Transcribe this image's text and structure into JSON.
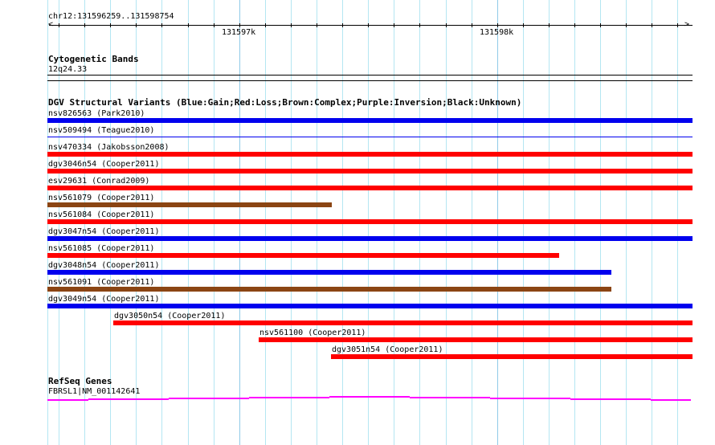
{
  "ruler": {
    "region": "chr12:131596259..131598754",
    "ticks": [
      "131597k",
      "131598k"
    ]
  },
  "cytoband": {
    "title": "Cytogenetic Bands",
    "band": "12q24.33"
  },
  "dgv": {
    "title": "DGV Structural Variants (Blue:Gain;Red:Loss;Brown:Complex;Purple:Inversion;Black:Unknown)",
    "colors": {
      "gain": "#0000ee",
      "loss": "#ff0000",
      "complex": "#8b4513"
    },
    "rows": [
      {
        "label": "nsv826563 (Park2010)",
        "type": "gain"
      },
      {
        "label": "nsv509494 (Teague2010)",
        "type": "gain"
      },
      {
        "label": "nsv470334 (Jakobsson2008)",
        "type": "loss"
      },
      {
        "label": "dgv3046n54 (Cooper2011)",
        "type": "loss"
      },
      {
        "label": "esv29631 (Conrad2009)",
        "type": "loss"
      },
      {
        "label": "nsv561079 (Cooper2011)",
        "type": "complex"
      },
      {
        "label": "nsv561084 (Cooper2011)",
        "type": "loss"
      },
      {
        "label": "dgv3047n54 (Cooper2011)",
        "type": "gain"
      },
      {
        "label": "nsv561085 (Cooper2011)",
        "type": "loss"
      },
      {
        "label": "dgv3048n54 (Cooper2011)",
        "type": "gain"
      },
      {
        "label": "nsv561091 (Cooper2011)",
        "type": "complex"
      },
      {
        "label": "dgv3049n54 (Cooper2011)",
        "type": "gain"
      },
      {
        "label": "dgv3050n54 (Cooper2011)",
        "type": "loss"
      },
      {
        "label": "nsv561100 (Cooper2011)",
        "type": "loss"
      },
      {
        "label": "dgv3051n54 (Cooper2011)",
        "type": "loss"
      }
    ]
  },
  "refseq": {
    "title": "RefSeq Genes",
    "gene": "FBRSL1|NM_001142641",
    "color": "#ff00ff"
  }
}
